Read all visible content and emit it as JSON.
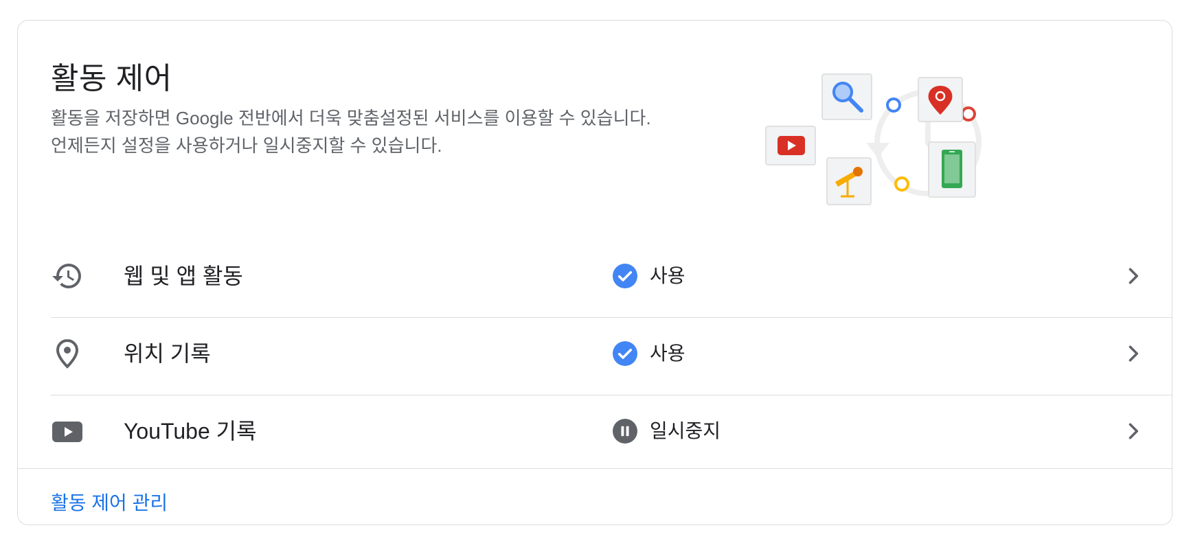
{
  "card": {
    "title": "활동 제어",
    "description_line1": "활동을 저장하면 Google 전반에서 더욱 맞춤설정된 서비스를 이용할 수 있습니다.",
    "description_line2": "언제든지 설정을 사용하거나 일시중지할 수 있습니다."
  },
  "rows": [
    {
      "label": "웹 및 앱 활동",
      "icon": "history-icon",
      "status": "사용",
      "status_icon": "check-circle-icon"
    },
    {
      "label": "위치 기록",
      "icon": "location-pin-icon",
      "status": "사용",
      "status_icon": "check-circle-icon"
    },
    {
      "label": "YouTube 기록",
      "icon": "youtube-icon",
      "status": "일시중지",
      "status_icon": "pause-circle-icon"
    }
  ],
  "footer": {
    "manage_link": "활동 제어 관리"
  },
  "colors": {
    "accent": "#1a73e8",
    "check": "#4285f4",
    "pause": "#5f6368",
    "icon": "#5f6368",
    "divider": "#dadce0"
  }
}
